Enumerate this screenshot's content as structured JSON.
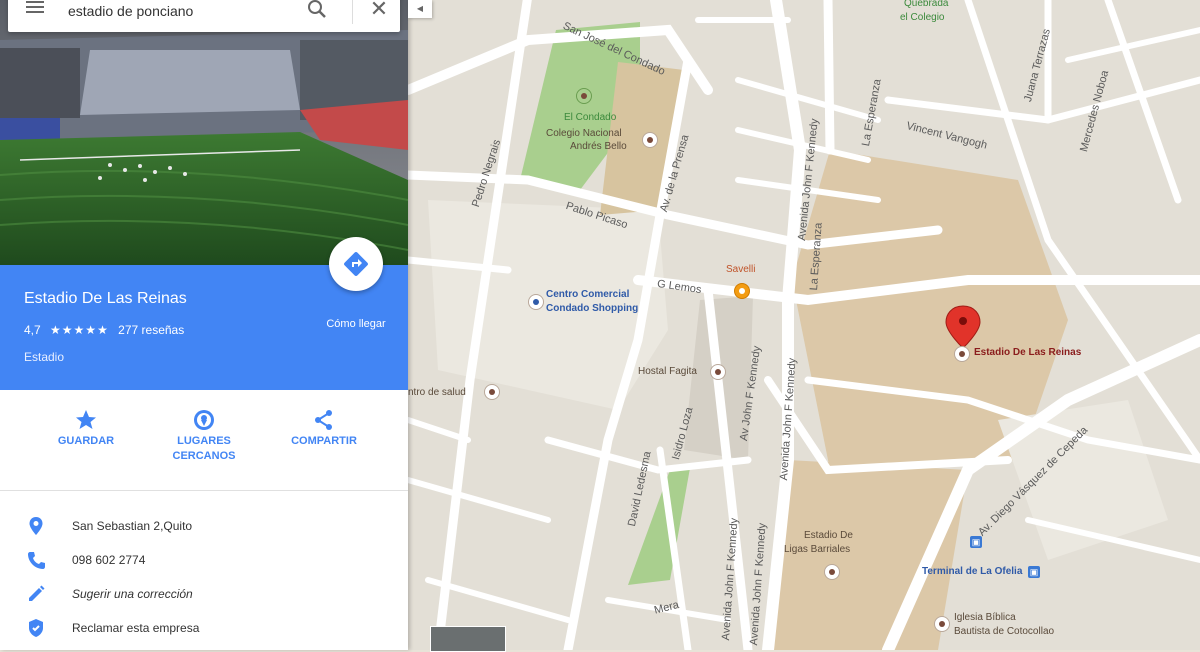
{
  "search": {
    "value": "estadio de ponciano",
    "close_glyph": "✕"
  },
  "place": {
    "title": "Estadio De Las Reinas",
    "rating": "4,7",
    "stars": "★★★★★",
    "reviews": "277 reseñas",
    "type": "Estadio",
    "directions_label": "Cómo llegar"
  },
  "actions": [
    {
      "label_1": "GUARDAR",
      "label_2": "",
      "icon": "star-icon"
    },
    {
      "label_1": "LUGARES",
      "label_2": "CERCANOS",
      "icon": "nearby-icon"
    },
    {
      "label_1": "COMPARTIR",
      "label_2": "",
      "icon": "share-icon"
    }
  ],
  "info": {
    "address": "San Sebastian 2,Quito",
    "phone": "098 602 2774",
    "suggest": "Sugerir una corrección",
    "claim": "Reclamar esta empresa"
  },
  "colors": {
    "accent": "#4285f4",
    "map_bg": "#e3dfd6",
    "road": "#ffffff",
    "block": "#d9cdb8",
    "stadium_area": "#dcc8a8",
    "park": "#a9cf8e"
  },
  "map": {
    "streets": {
      "san_jose": "San José del Condado",
      "pedro_negrais": "Pedro Negrais",
      "pablo_picaso": "Pablo Picaso",
      "av_de_la_prensa": "Av. de la Prensa",
      "g_lemos": "G Lemos",
      "la_esperanza": "La Esperanza",
      "la_esperanza_2": "La Esperanza",
      "av_jfk_1": "Avenida John F Kennedy",
      "av_jfk_2": "Avenida John F Kennedy",
      "av_jfk_3": "Avenida John F Kennedy",
      "av_jfk_4": "Av John F Kennedy",
      "av_jfk_5": "Avenida John F Kennedy",
      "vincent_vangogh": "Vincent Vangogh",
      "juana_terrazas": "Juana Terrazas",
      "mercedes_noboa": "Mercedes Noboa",
      "isidro_loza": "Isidro Loza",
      "david_ledesma": "David Ledesma",
      "mera": "Mera",
      "av_diego": "Av. Diego Vásquez de Cepeda",
      "quebrada_1": "Quebrada",
      "quebrada_2": "el Colegio"
    },
    "pois": {
      "el_condado": "El Condado",
      "colegio_1": "Colegio Nacional",
      "colegio_2": "Andrés Bello",
      "centro_1": "Centro Comercial",
      "centro_2": "Condado Shopping",
      "savelli": "Savelli",
      "hostal": "Hostal Fagita",
      "salud": "ntro de salud",
      "estadio_reinas": "Estadio De Las Reinas",
      "ligas_1": "Estadio De",
      "ligas_2": "Ligas Barriales",
      "terminal": "Terminal de La Ofelia",
      "iglesia_1": "Iglesia Bíblica",
      "iglesia_2": "Bautista de Cotocollao"
    }
  }
}
